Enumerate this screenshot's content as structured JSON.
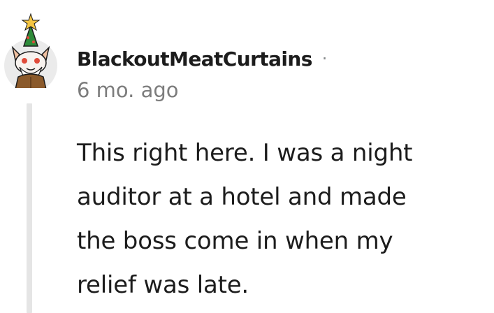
{
  "comment": {
    "author": "BlackoutMeatCurtains",
    "separator": "·",
    "timestamp": "6 mo. ago",
    "body_lines": [
      "This right here. I was a night",
      "auditor at a hotel and made",
      "the boss come in when my",
      "relief was late."
    ],
    "avatar_icon": "festive-cat-avatar-icon"
  },
  "colors": {
    "text_primary": "#1c1c1c",
    "text_meta": "#7c7c7c",
    "thread_line": "#e5e5e5"
  }
}
